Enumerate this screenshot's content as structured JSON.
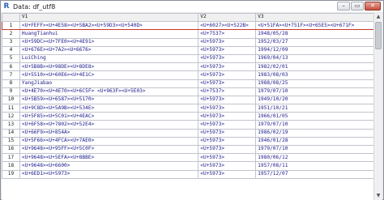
{
  "window": {
    "title": "Data: df_utf8",
    "controls": {
      "minimize": "–",
      "maximize": "▭",
      "close": "✕"
    }
  },
  "grid": {
    "columns": [
      "",
      "V1",
      "V2",
      "V3"
    ],
    "rows": [
      [
        "1",
        "<U+FEFF><U+4E58><U+5BA2><U+59D3><U+540D>",
        "<U+6027><U+522B>",
        "<U+51FA><U+751F><U+65E5><U+671F>"
      ],
      [
        "2",
        "HuangTianhui",
        "<U+7537>",
        "1948/05/28"
      ],
      [
        "3",
        "<U+59DC><U+7FE0><U+4E91>",
        "<U+5973>",
        "1952/03/27"
      ],
      [
        "4",
        "<U+676E><U+7A2><U+6676>",
        "<U+5973>",
        "1994/12/09"
      ],
      [
        "5",
        "LuiChing",
        "<U+5973>",
        "1969/04/13"
      ],
      [
        "6",
        "<U+5B8B><U+98DE><U+8DE8>",
        "<U+5973>",
        "1982/02/01"
      ],
      [
        "7",
        "<U+5510><U+60E6><U+4E1C>",
        "<U+5973>",
        "1983/08/03"
      ],
      [
        "8",
        "YangJiabao",
        "<U+5973>",
        "1988/08/25"
      ],
      [
        "9",
        "<U+4E70><U+4E70><U+6C5F> <U+963F><U+5E03>",
        "<U+7537>",
        "1979/07/10"
      ],
      [
        "10",
        "<U+5B59><U+6587><U+5170>",
        "<U+5973>",
        "1949/10/20"
      ],
      [
        "11",
        "<U+9C8D><U+5A9B><U+534E>",
        "<U+5973>",
        "1951/10/21"
      ],
      [
        "12",
        "<U+5F85><U+5C01><U+4EAC>",
        "<U+5973>",
        "1966/01/05"
      ],
      [
        "13",
        "<U+6F58><U+7802><U+52E4>",
        "<U+5973>",
        "1979/07/10"
      ],
      [
        "14",
        "<U+66F9><U+854A>",
        "<U+5973>",
        "1986/02/19"
      ],
      [
        "15",
        "<U+5F66><U+4FCA><U+7AE0>",
        "<U+5973>",
        "1946/01/28"
      ],
      [
        "16",
        "<U+9648><U+95FF><U+5C0F>",
        "<U+5973>",
        "1979/07/10"
      ],
      [
        "17",
        "<U+9648><U+5EFA><U+8BBE>",
        "<U+5973>",
        "1980/06/12"
      ],
      [
        "18",
        "<U+9648><U+6600>",
        "<U+5973>",
        "1957/08/11"
      ],
      [
        "19",
        "<U+6ED1><U+5973>",
        "<U+5973>",
        "1957/12/07"
      ]
    ]
  },
  "colors": {
    "cell_text": "#1a1a8c",
    "selection_border": "#c8392b",
    "grid_line": "#c0c4cc"
  },
  "icons": {
    "app": "R",
    "scroll_up": "▲",
    "scroll_down": "▼"
  }
}
